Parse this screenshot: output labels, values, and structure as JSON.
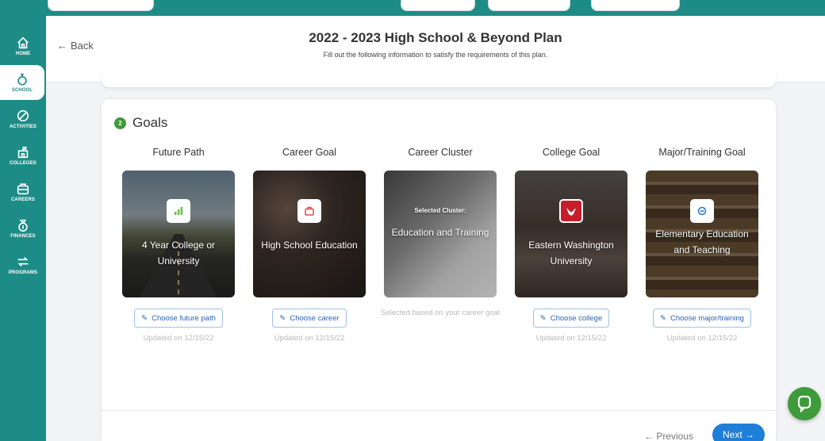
{
  "header": {
    "back_label": "Back",
    "title": "2022 - 2023 High School & Beyond Plan",
    "subtitle": "Fill out the following information to satisfy the requirements of this plan."
  },
  "sidebar": {
    "items": [
      {
        "label": "HOME",
        "icon": "home-icon"
      },
      {
        "label": "SCHOOL",
        "icon": "school-icon"
      },
      {
        "label": "ACTIVITIES",
        "icon": "activities-icon"
      },
      {
        "label": "COLLEGES",
        "icon": "college-icon"
      },
      {
        "label": "CAREERS",
        "icon": "briefcase-icon"
      },
      {
        "label": "FINANCES",
        "icon": "money-bag-icon"
      },
      {
        "label": "PROGRAMS",
        "icon": "programs-icon"
      }
    ],
    "active": "SCHOOL"
  },
  "section": {
    "step_number": "2",
    "title": "Goals"
  },
  "goals": [
    {
      "heading": "Future Path",
      "caption": "4 Year College or University",
      "button_label": "Choose future path",
      "updated": "Updated on 12/15/22",
      "icon": "chart-icon"
    },
    {
      "heading": "Career Goal",
      "caption": "High School Education",
      "button_label": "Choose career",
      "updated": "Updated on 12/15/22",
      "icon": "briefcase-icon"
    },
    {
      "heading": "Career Cluster",
      "small_label": "Selected Cluster:",
      "caption": "Education and Training",
      "note": "Selected based on your career goal"
    },
    {
      "heading": "College Goal",
      "caption": "Eastern Washington University",
      "button_label": "Choose college",
      "updated": "Updated on 12/15/22",
      "icon": "college-logo-icon"
    },
    {
      "heading": "Major/Training Goal",
      "caption": "Elementary Education and Teaching",
      "button_label": "Choose major/training",
      "updated": "Updated on 12/15/22",
      "icon": "graduation-icon"
    }
  ],
  "footer": {
    "previous_label": "Previous",
    "next_label": "Next"
  },
  "colors": {
    "brand_teal": "#1e8c86",
    "step_green": "#3e9a3a",
    "link_blue": "#2a64b8",
    "next_blue": "#1f7ed8"
  }
}
